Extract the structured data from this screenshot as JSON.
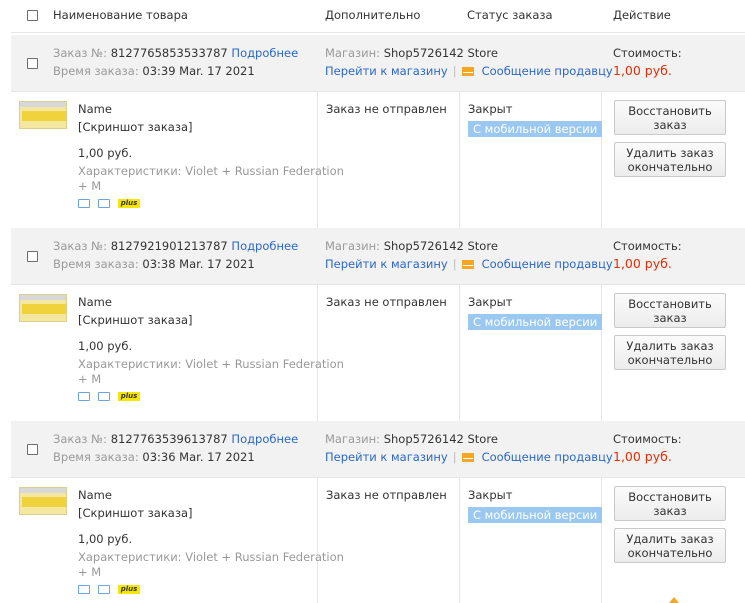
{
  "header": {
    "product": "Наименование товара",
    "extra": "Дополнительно",
    "status": "Статус заказа",
    "action": "Действие"
  },
  "orders": [
    {
      "order_label": "Заказ №:",
      "order_no": "8127765853533787",
      "details_link": "Подробнее",
      "time_label": "Время заказа:",
      "time": "03:39 Mar. 17 2021",
      "store_label": "Магазин:",
      "store": "Shop5726142 Store",
      "go_store": "Перейти к магазину",
      "separator": "|",
      "message_seller": "Сообщение продавцу",
      "cost_label": "Стоимость:",
      "cost": "1,00 руб.",
      "item_name": "Name",
      "item_screenshot": "[Скриншот заказа]",
      "item_price": "1,00 руб.",
      "item_chars_1": "Характеристики: Violet + Russian Federation",
      "item_chars_2": "+ M",
      "plus_badge": "plus",
      "shipping_status": "Заказ не отправлен",
      "order_status": "Закрыт",
      "mobile_badge": "С мобильной версии",
      "restore_btn_1": "Восстановить",
      "restore_btn_2": "заказ",
      "delete_btn_1": "Удалить заказ",
      "delete_btn_2": "окончательно"
    },
    {
      "order_label": "Заказ №:",
      "order_no": "8127921901213787",
      "details_link": "Подробнее",
      "time_label": "Время заказа:",
      "time": "03:38 Mar. 17 2021",
      "store_label": "Магазин:",
      "store": "Shop5726142 Store",
      "go_store": "Перейти к магазину",
      "separator": "|",
      "message_seller": "Сообщение продавцу",
      "cost_label": "Стоимость:",
      "cost": "1,00 руб.",
      "item_name": "Name",
      "item_screenshot": "[Скриншот заказа]",
      "item_price": "1,00 руб.",
      "item_chars_1": "Характеристики: Violet + Russian Federation",
      "item_chars_2": "+ M",
      "plus_badge": "plus",
      "shipping_status": "Заказ не отправлен",
      "order_status": "Закрыт",
      "mobile_badge": "С мобильной версии",
      "restore_btn_1": "Восстановить",
      "restore_btn_2": "заказ",
      "delete_btn_1": "Удалить заказ",
      "delete_btn_2": "окончательно"
    },
    {
      "order_label": "Заказ №:",
      "order_no": "8127763539613787",
      "details_link": "Подробнее",
      "time_label": "Время заказа:",
      "time": "03:36 Mar. 17 2021",
      "store_label": "Магазин:",
      "store": "Shop5726142 Store",
      "go_store": "Перейти к магазину",
      "separator": "|",
      "message_seller": "Сообщение продавцу",
      "cost_label": "Стоимость:",
      "cost": "1,00 руб.",
      "item_name": "Name",
      "item_screenshot": "[Скриншот заказа]",
      "item_price": "1,00 руб.",
      "item_chars_1": "Характеристики: Violet + Russian Federation",
      "item_chars_2": "+ M",
      "plus_badge": "plus",
      "shipping_status": "Заказ не отправлен",
      "order_status": "Закрыт",
      "mobile_badge": "С мобильной версии",
      "restore_btn_1": "Восстановить",
      "restore_btn_2": "заказ",
      "delete_btn_1": "Удалить заказ",
      "delete_btn_2": "окончательно"
    }
  ],
  "colors": {
    "link": "#2b67c5",
    "price": "#e62e04",
    "mobile_badge": "#9bc8f0",
    "header_row_bg": "#f2f2f2"
  }
}
